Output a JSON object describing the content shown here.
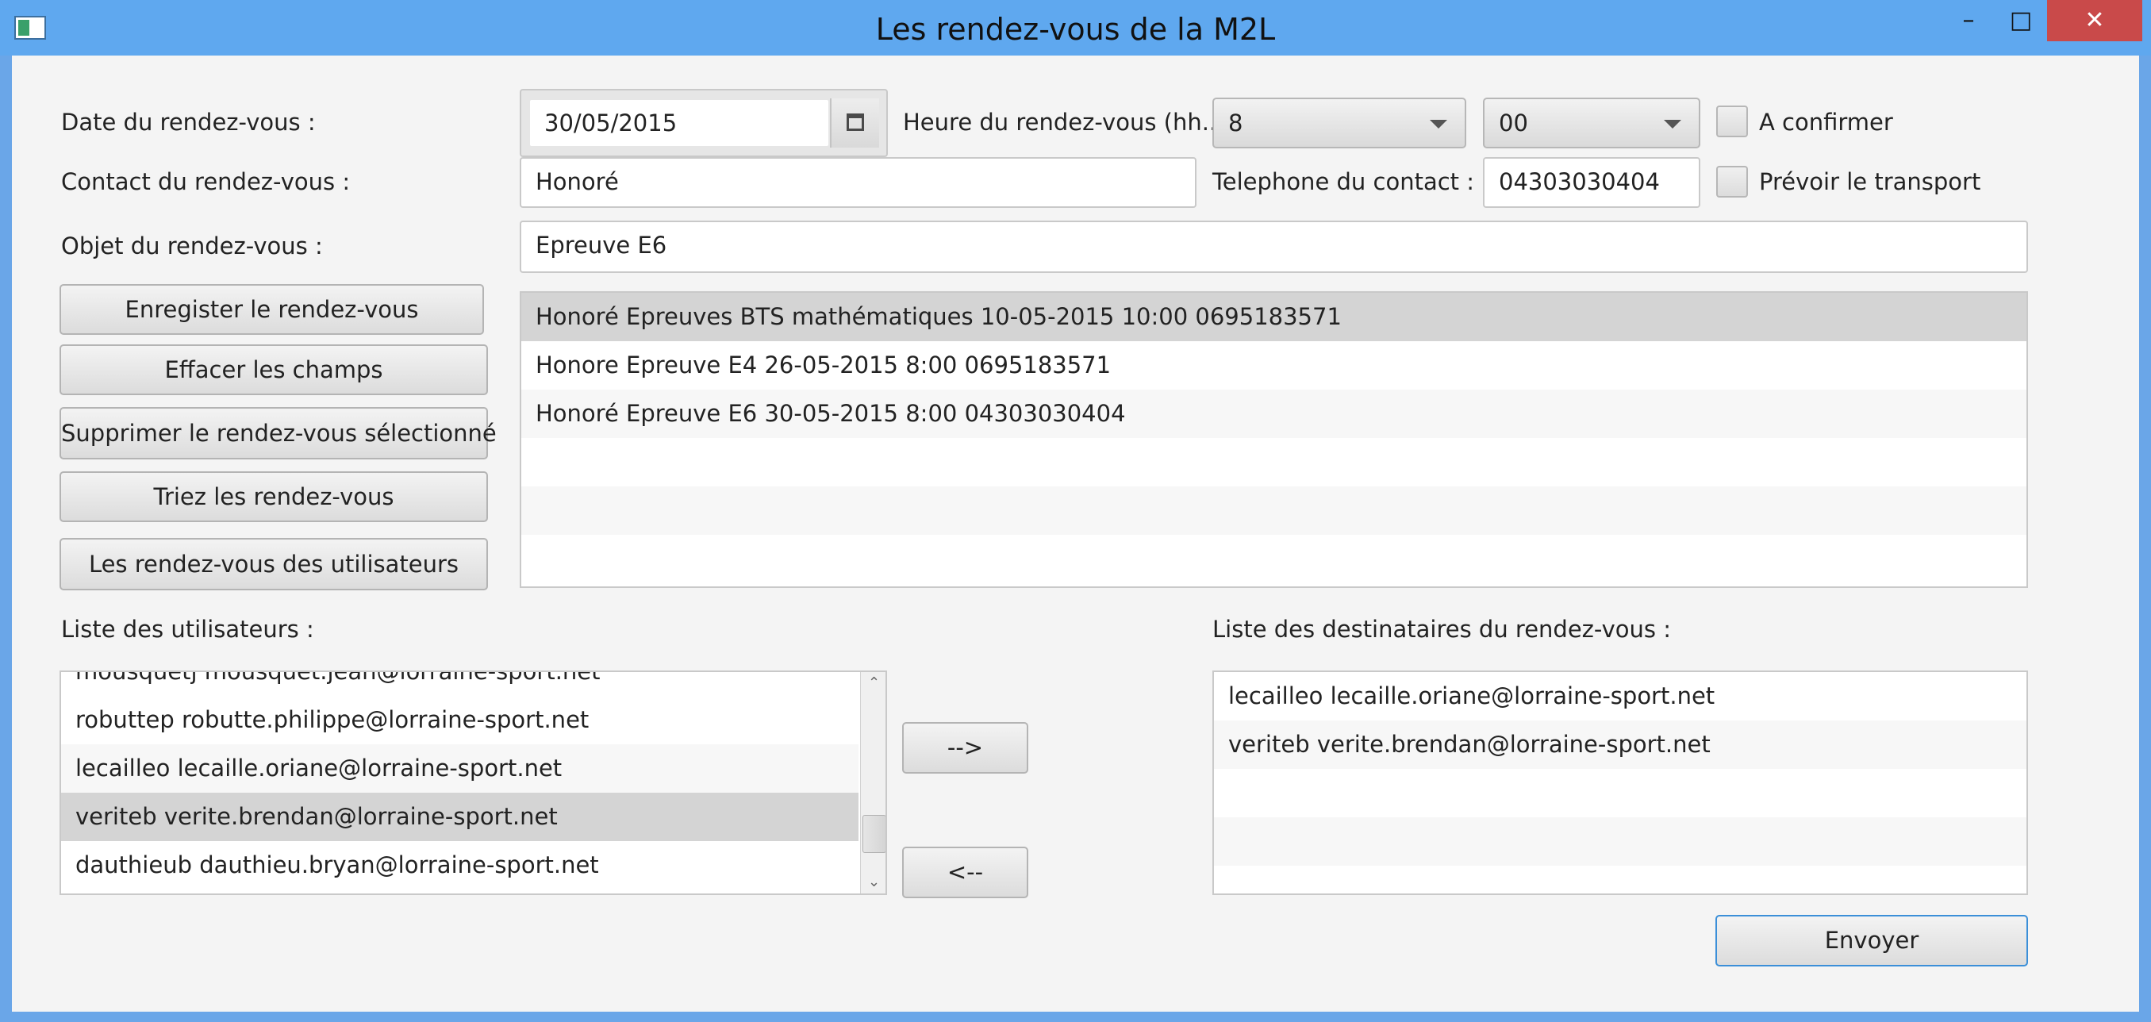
{
  "window": {
    "title": "Les rendez-vous de la M2L",
    "minimize": "–",
    "maximize": "□",
    "close": "✕"
  },
  "form": {
    "date_label": "Date du rendez-vous :",
    "date_value": "30/05/2015",
    "hour_label": "Heure du rendez-vous (hh...",
    "hour_value": "8",
    "minute_value": "00",
    "confirm_label": "A confirmer",
    "contact_label": "Contact du rendez-vous :",
    "contact_value": "Honoré",
    "phone_label": "Telephone du contact :",
    "phone_value": "04303030404",
    "transport_label": "Prévoir le transport",
    "object_label": "Objet du rendez-vous :",
    "object_value": "Epreuve E6"
  },
  "actions": {
    "save": "Enregister le rendez-vous",
    "clear": "Effacer les champs",
    "delete": "Supprimer le rendez-vous sélectionné",
    "sort": "Triez les rendez-vous",
    "user_appointments": "Les rendez-vous des utilisateurs"
  },
  "appointments": [
    "Honoré Epreuves BTS mathématiques 10-05-2015 10:00 0695183571",
    "Honore Epreuve E4  26-05-2015 8:00 0695183571",
    "Honoré Epreuve E6 30-05-2015 8:00 04303030404"
  ],
  "users": {
    "label": "Liste des utilisateurs :",
    "items": [
      "mousquetj mousquet.jean@lorraine-sport.net",
      "robuttep robutte.philippe@lorraine-sport.net",
      "lecailleo lecaille.oriane@lorraine-sport.net",
      "veriteb verite.brendan@lorraine-sport.net",
      "dauthieub dauthieu.bryan@lorraine-sport.net"
    ]
  },
  "transfer": {
    "add": "-->",
    "remove": "<--"
  },
  "recipients": {
    "label": "Liste des destinataires du rendez-vous :",
    "items": [
      "lecailleo lecaille.oriane@lorraine-sport.net",
      "veriteb verite.brendan@lorraine-sport.net"
    ]
  },
  "send": "Envoyer"
}
